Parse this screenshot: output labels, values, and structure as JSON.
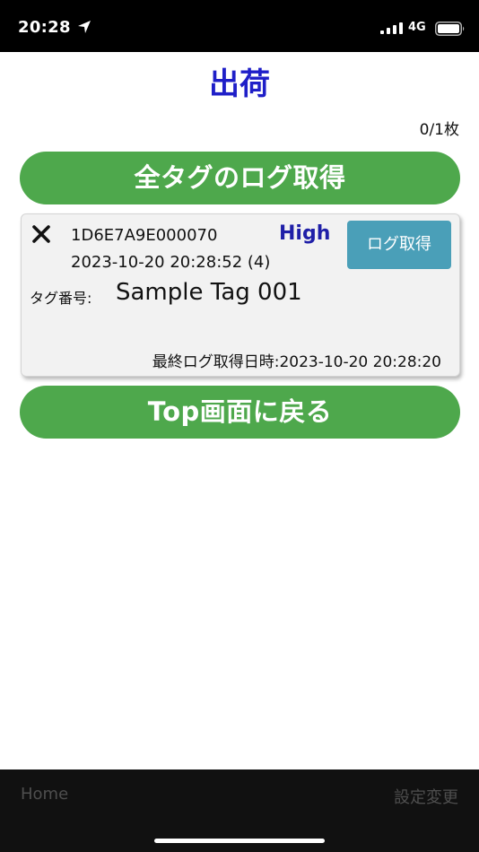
{
  "status_bar": {
    "time": "20:28",
    "network": "4G"
  },
  "header": {
    "title": "出荷",
    "count": "0/1枚"
  },
  "buttons": {
    "get_all_logs": "全タグのログ取得",
    "back_to_top": "Top画面に戻る"
  },
  "tag_card": {
    "tag_id": "1D6E7A9E000070",
    "level": "High",
    "log_button": "ログ取得",
    "datetime": "2023-10-20 20:28:52 (4)",
    "tag_number_label": "タグ番号:",
    "tag_number_value": "Sample Tag 001",
    "last_log": "最終ログ取得日時:2023-10-20 20:28:20"
  },
  "bottom_nav": {
    "home": "Home",
    "settings": "設定変更"
  },
  "colors": {
    "title_blue": "#1f1fc8",
    "button_green": "#4ea84c",
    "log_button_teal": "#4a9fb8"
  },
  "icons": {
    "location": "location-arrow-icon",
    "signal": "signal-bars-icon",
    "battery": "battery-icon",
    "close": "close-icon"
  }
}
